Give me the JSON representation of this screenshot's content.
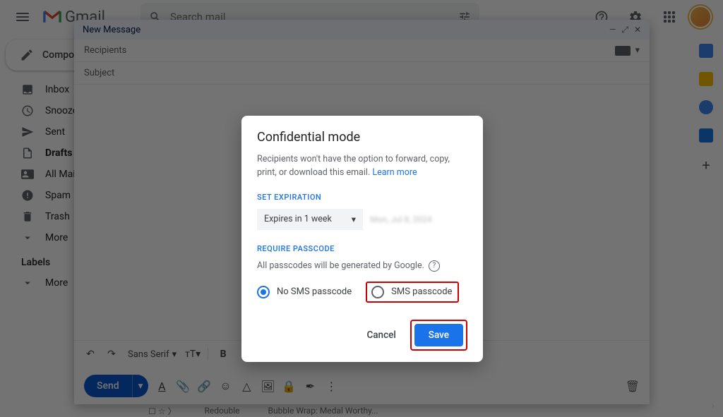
{
  "header": {
    "app_name": "Gmail",
    "search_placeholder": "Search mail"
  },
  "sidebar": {
    "compose_label": "Compose",
    "items": [
      {
        "label": "Inbox"
      },
      {
        "label": "Snoozed"
      },
      {
        "label": "Sent"
      },
      {
        "label": "Drafts"
      },
      {
        "label": "All Mail"
      },
      {
        "label": "Spam"
      },
      {
        "label": "Trash"
      },
      {
        "label": "More"
      }
    ],
    "labels_header": "Labels",
    "labels_more": "More"
  },
  "compose": {
    "title": "New Message",
    "recipients_placeholder": "Recipients",
    "subject_placeholder": "Subject",
    "font_family": "Sans Serif",
    "send_label": "Send"
  },
  "modal": {
    "title": "Confidential mode",
    "description": "Recipients won't have the option to forward, copy, print, or download this email.",
    "learn_more": "Learn more",
    "set_expiration_label": "SET EXPIRATION",
    "expiration_value": "Expires in 1 week",
    "expiration_date_hint": "Mon, Jul 8, 2024",
    "require_passcode_label": "REQUIRE PASSCODE",
    "passcode_desc": "All passcodes will be generated by Google.",
    "radio_no_sms": "No SMS passcode",
    "radio_sms": "SMS passcode",
    "cancel_label": "Cancel",
    "save_label": "Save"
  },
  "peek": {
    "sender": "Redouble",
    "subject": "Bubble Wrap: Medal Worthy..."
  }
}
